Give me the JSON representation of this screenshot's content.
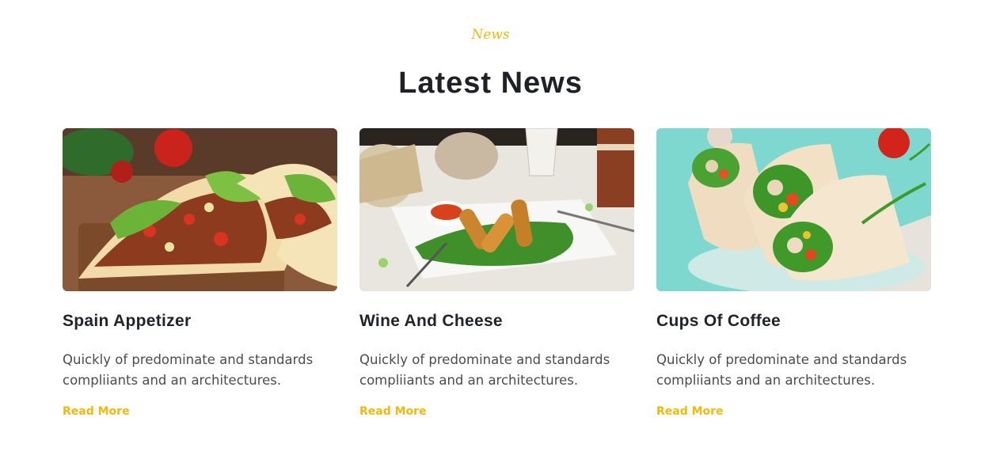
{
  "section": {
    "eyebrow": "News",
    "title": "Latest News",
    "accent_color": "#f0b90b"
  },
  "cards": [
    {
      "image_icon": "tacos-photo",
      "title": "Spain Appetizer",
      "text": "Quickly of predominate and standards compliiants and an architectures.",
      "link": "Read More"
    },
    {
      "image_icon": "fried-cheese-sticks-photo",
      "title": "Wine And Cheese",
      "text": "Quickly of predominate and standards compliiants and an architectures.",
      "link": "Read More"
    },
    {
      "image_icon": "wraps-photo",
      "title": "Cups Of Coffee",
      "text": "Quickly of predominate and standards compliiants and an architectures.",
      "link": "Read More"
    }
  ]
}
